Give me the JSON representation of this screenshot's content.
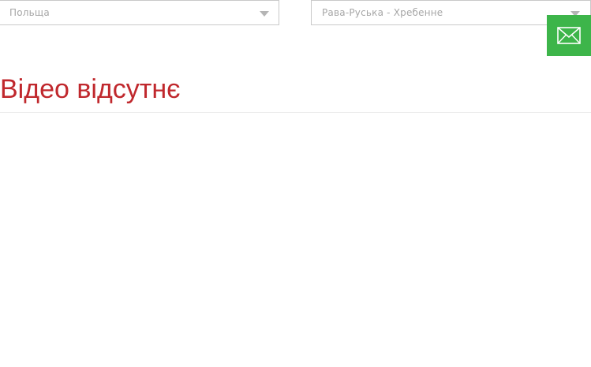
{
  "filters": {
    "country": {
      "selected": "Польща"
    },
    "crossing": {
      "selected": "Рава-Руська - Хребенне"
    }
  },
  "contact": {
    "icon": "envelope-icon",
    "color": "#3db54a"
  },
  "video": {
    "message": "Відео відсутнє",
    "color": "#c0282d"
  }
}
